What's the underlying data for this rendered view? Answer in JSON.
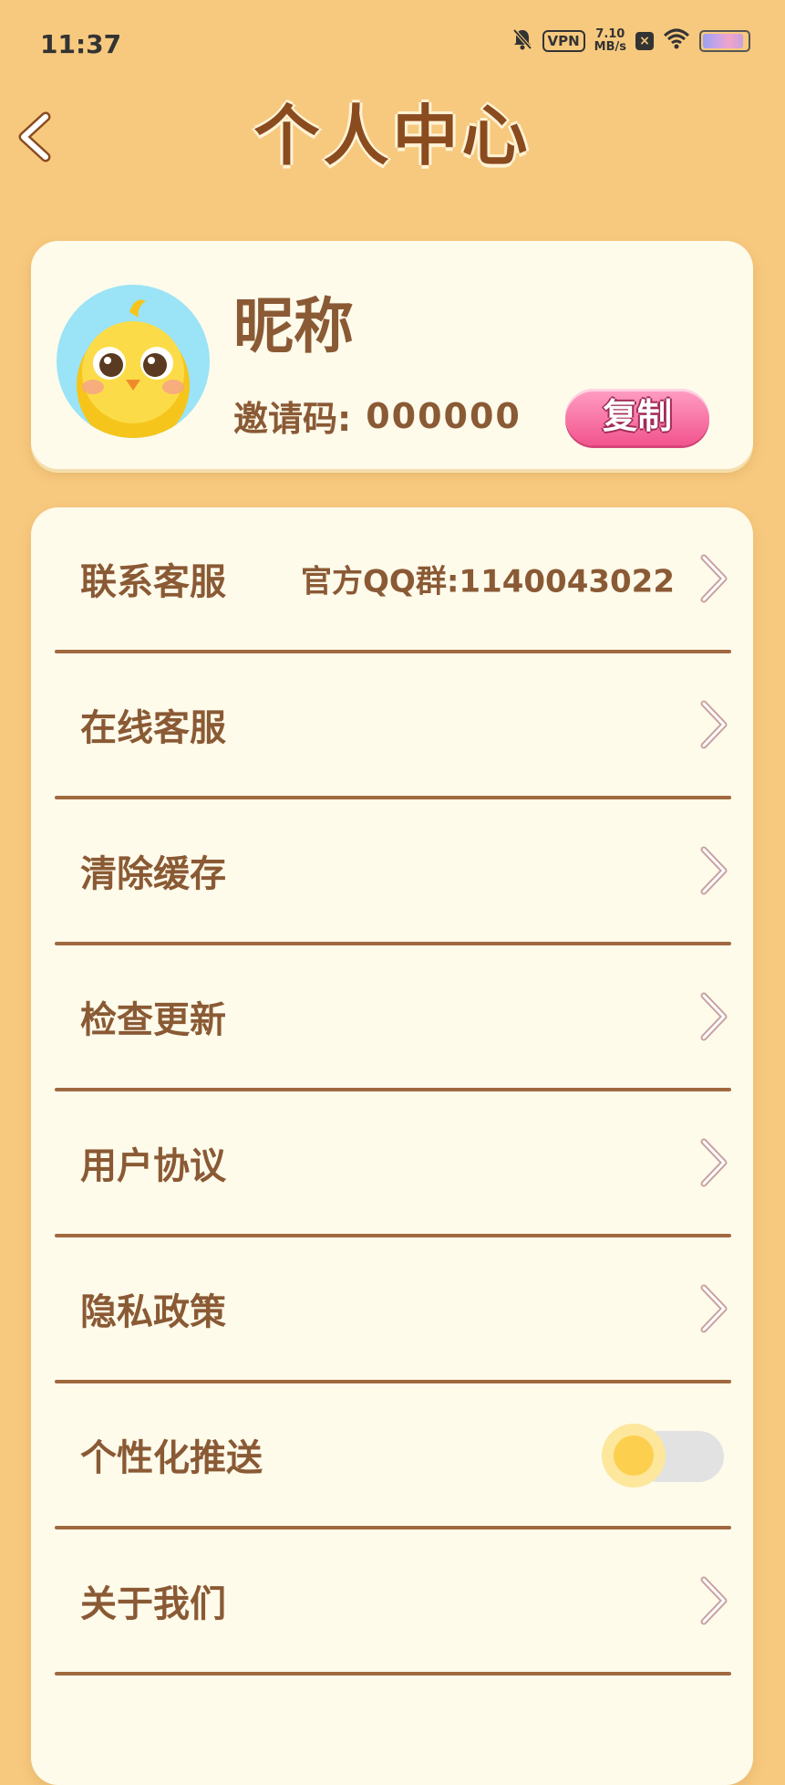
{
  "status_bar": {
    "time": "11:37",
    "vpn_label": "VPN",
    "speed_value": "7.10",
    "speed_unit": "MB/s",
    "icons": [
      "bell-off-icon",
      "vpn-icon",
      "close-box-icon",
      "wifi-icon",
      "battery-icon"
    ]
  },
  "header": {
    "title": "个人中心",
    "back_icon": "chevron-left-icon"
  },
  "profile": {
    "nickname": "昵称",
    "invite_label": "邀请码:",
    "invite_code": "000000",
    "copy_label": "复制",
    "avatar": "yellow-chick-avatar"
  },
  "menu": {
    "items": [
      {
        "label": "联系客服",
        "value": "官方QQ群:1140043022",
        "type": "link"
      },
      {
        "label": "在线客服",
        "type": "link"
      },
      {
        "label": "清除缓存",
        "type": "link"
      },
      {
        "label": "检查更新",
        "type": "link"
      },
      {
        "label": "用户协议",
        "type": "link"
      },
      {
        "label": "隐私政策",
        "type": "link"
      },
      {
        "label": "个性化推送",
        "type": "toggle",
        "enabled": false
      },
      {
        "label": "关于我们",
        "type": "link"
      }
    ]
  },
  "colors": {
    "background": "#f7c97e",
    "card": "#fefbeb",
    "text_brown": "#8a5a35",
    "title_brown": "#8a4b1f",
    "divider": "#a0693f",
    "copy_button_pink": "#f2548e",
    "toggle_yellow": "#fccf4f"
  }
}
